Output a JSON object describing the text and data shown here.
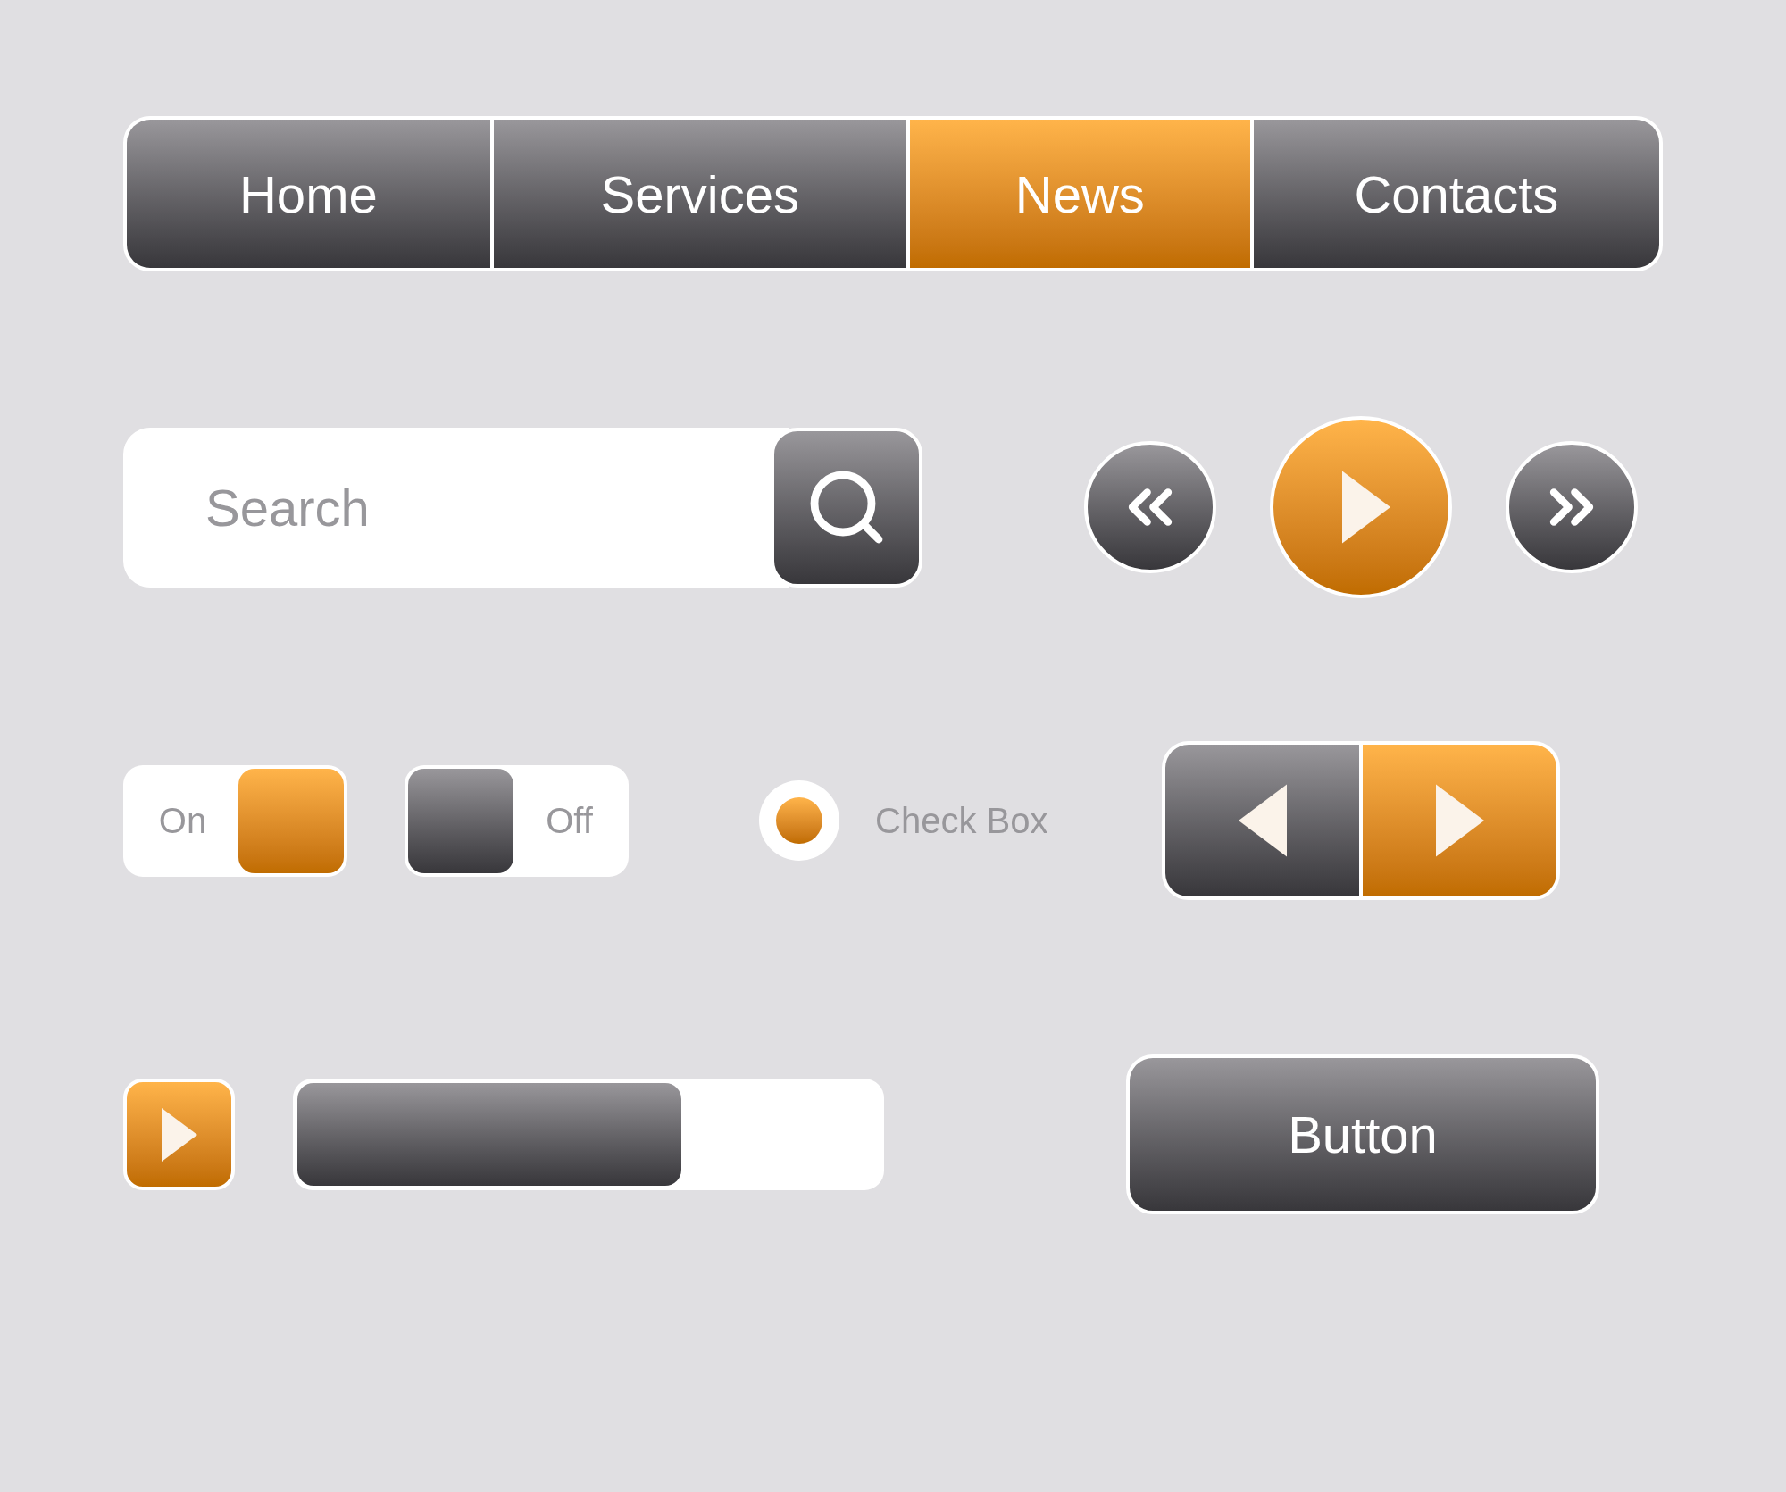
{
  "nav": {
    "tabs": [
      {
        "label": "Home",
        "selected": false
      },
      {
        "label": "Services",
        "selected": false
      },
      {
        "label": "News",
        "selected": true
      },
      {
        "label": "Contacts",
        "selected": false
      }
    ]
  },
  "search": {
    "placeholder": "Search"
  },
  "media_controls": [
    {
      "kind": "rewind",
      "selected": false
    },
    {
      "kind": "play",
      "selected": true
    },
    {
      "kind": "forward",
      "selected": false
    }
  ],
  "toggles": [
    {
      "label": "On",
      "on": true
    },
    {
      "label": "Off",
      "on": false
    }
  ],
  "radio": {
    "label": "Check Box",
    "checked": true
  },
  "pager": [
    {
      "kind": "previous",
      "selected": false
    },
    {
      "kind": "next",
      "selected": true
    }
  ],
  "progress": {
    "level": 0.66
  },
  "button": {
    "label": "Button"
  }
}
